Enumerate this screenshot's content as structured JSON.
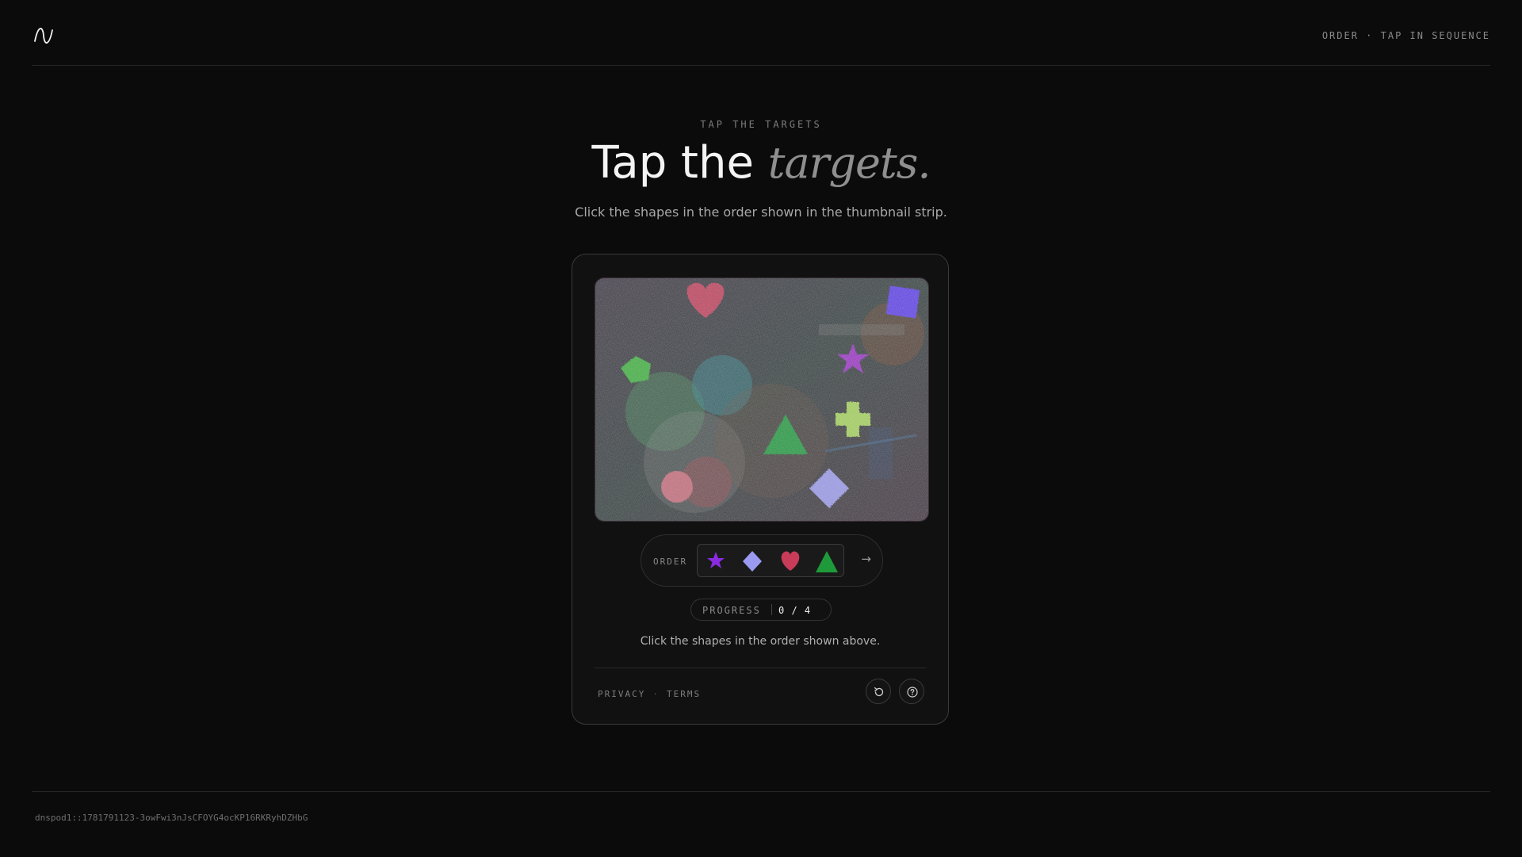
{
  "header": {
    "logo_icon": "wave-logo-icon",
    "mode_label": "ORDER · TAP IN SEQUENCE"
  },
  "hero": {
    "eyebrow": "TAP THE TARGETS",
    "title_plain": "Tap the ",
    "title_emphasis": "targets.",
    "subtitle": "Click the shapes in the order shown in the thumbnail strip."
  },
  "challenge": {
    "canvas_icon": "captcha-shapes-canvas",
    "order": {
      "label": "ORDER",
      "sequence": [
        {
          "shape": "star-icon",
          "color": "#8a2be2"
        },
        {
          "shape": "diamond-icon",
          "color": "#9a9af0"
        },
        {
          "shape": "heart-icon",
          "color": "#c83c5a"
        },
        {
          "shape": "triangle-icon",
          "color": "#1f9a3a"
        }
      ],
      "next_icon": "arrow-right-icon",
      "next_glyph": "→"
    },
    "progress": {
      "label": "PROGRESS",
      "value": "0 / 4",
      "completed": 0,
      "total": 4
    },
    "hint": "Click the shapes in the order shown above."
  },
  "footer": {
    "privacy": "PRIVACY",
    "separator": "·",
    "terms": "TERMS",
    "reload_icon": "reload-icon",
    "help_icon": "help-icon"
  },
  "bottom": {
    "sitekey": "dnspod1::1781791123-3owFwi3nJsCFOYG4ocKP16RKRyhDZHbG"
  }
}
